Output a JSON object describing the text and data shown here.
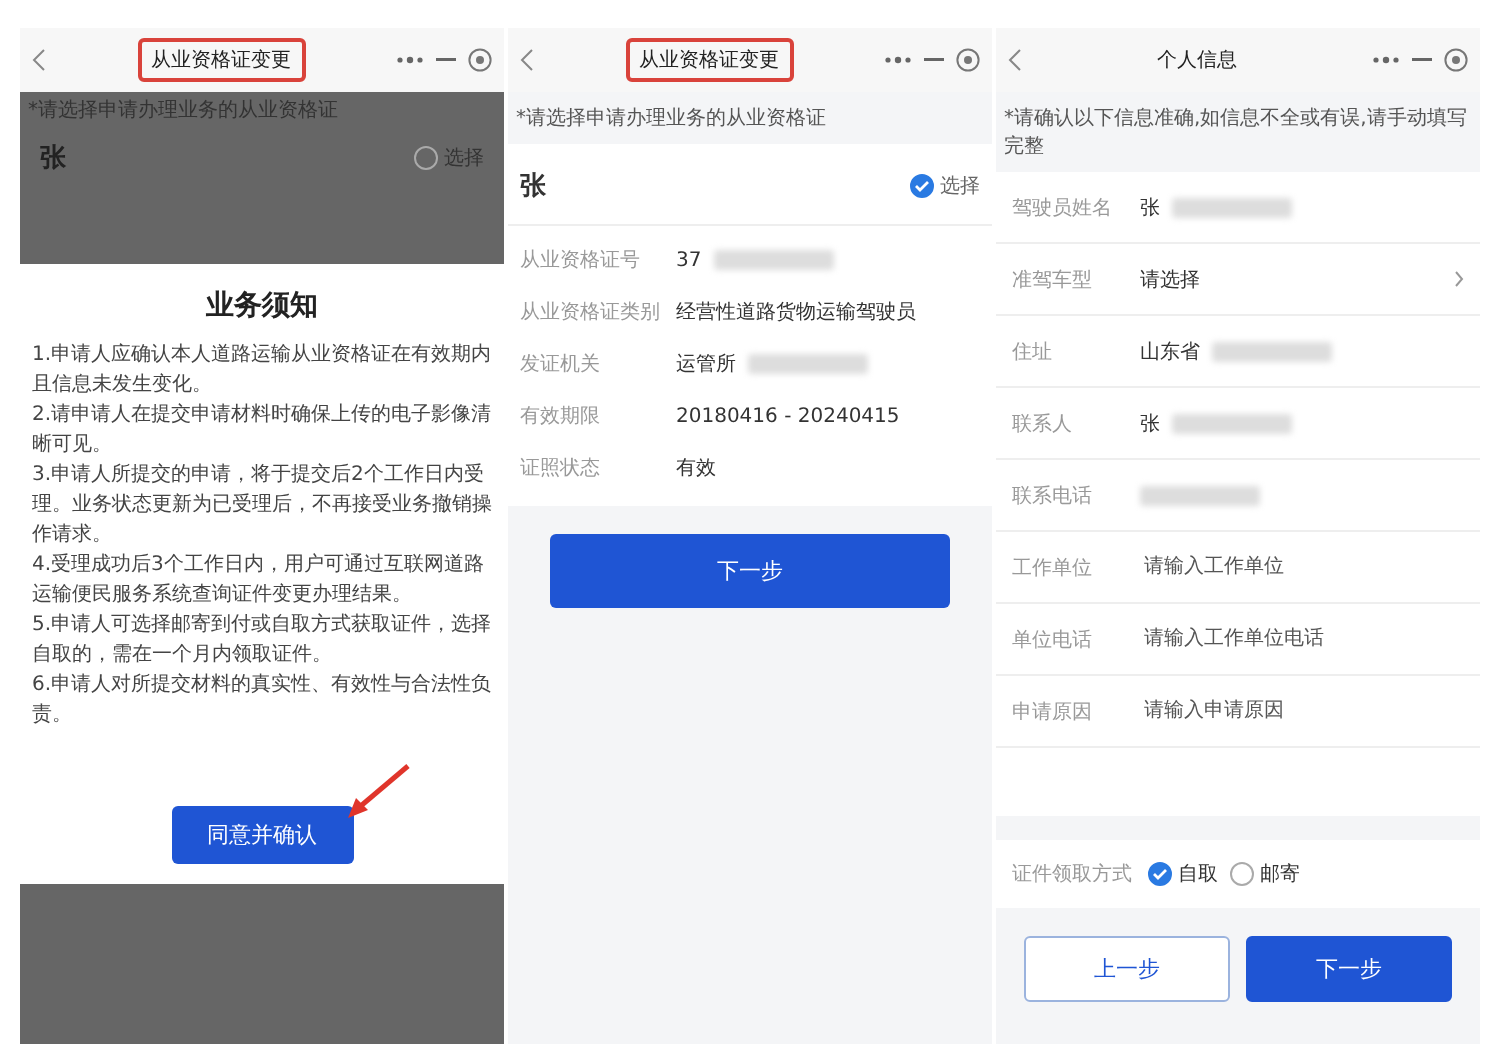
{
  "panels": [
    {
      "kind": "notice",
      "header": {
        "title": "从业资格证变更",
        "highlighted": true
      },
      "overlay": {
        "hint": "*请选择申请办理业务的从业资格证",
        "name": "张",
        "select_label": "选择",
        "selected": false
      },
      "notice": {
        "title": "业务须知",
        "items": [
          "1.申请人应确认本人道路运输从业资格证在有效期内且信息未发生变化。",
          "2.请申请人在提交申请材料时确保上传的电子影像清晰可见。",
          "3.申请人所提交的申请，将于提交后2个工作日内受理。业务状态更新为已受理后，不再接受业务撤销操作请求。",
          "4.受理成功后3个工作日内，用户可通过互联网道路运输便民服务系统查询证件变更办理结果。",
          "5.申请人可选择邮寄到付或自取方式获取证件，选择自取的，需在一个月内领取证件。",
          "6.申请人对所提交材料的真实性、有效性与合法性负责。"
        ],
        "button": "同意并确认",
        "arrow": true
      }
    },
    {
      "kind": "certificate",
      "header": {
        "title": "从业资格证变更",
        "highlighted": true
      },
      "hint": "*请选择申请办理业务的从业资格证",
      "card": {
        "name": "张",
        "select_label": "选择",
        "selected": true,
        "fields": [
          {
            "label": "从业资格证号",
            "value": "37",
            "blurred": true
          },
          {
            "label": "从业资格证类别",
            "value": "经营性道路货物运输驾驶员",
            "blurred": false
          },
          {
            "label": "发证机关",
            "value": "运管所",
            "blurred": true
          },
          {
            "label": "有效期限",
            "value": "20180416 - 20240415",
            "blurred": false
          },
          {
            "label": "证照状态",
            "value": "有效",
            "blurred": false
          }
        ]
      },
      "button": "下一步"
    },
    {
      "kind": "form",
      "header": {
        "title": "个人信息",
        "highlighted": false
      },
      "hint": "*请确认以下信息准确,如信息不全或有误,请手动填写完整",
      "rows": [
        {
          "label": "驾驶员姓名",
          "value": "张",
          "kind": "text",
          "blurred": true
        },
        {
          "label": "准驾车型",
          "value": "请选择",
          "kind": "select",
          "blurred": false
        },
        {
          "label": "住址",
          "value": "山东省",
          "kind": "text",
          "blurred": true
        },
        {
          "label": "联系人",
          "value": "张",
          "kind": "text",
          "blurred": true
        },
        {
          "label": "联系电话",
          "kind": "text",
          "blurred": true
        },
        {
          "label": "工作单位",
          "placeholder": "请输入工作单位",
          "kind": "input",
          "blurred": false
        },
        {
          "label": "单位电话",
          "placeholder": "请输入工作单位电话",
          "kind": "input",
          "blurred": false
        },
        {
          "label": "申请原因",
          "placeholder": "请输入申请原因",
          "kind": "input",
          "blurred": false
        }
      ],
      "pickup": {
        "label": "证件领取方式",
        "options": [
          {
            "label": "自取",
            "selected": true
          },
          {
            "label": "邮寄",
            "selected": false
          }
        ]
      },
      "buttons": [
        {
          "label": "上一步",
          "kind": "secondary"
        },
        {
          "label": "下一步",
          "kind": "primary"
        }
      ]
    }
  ]
}
